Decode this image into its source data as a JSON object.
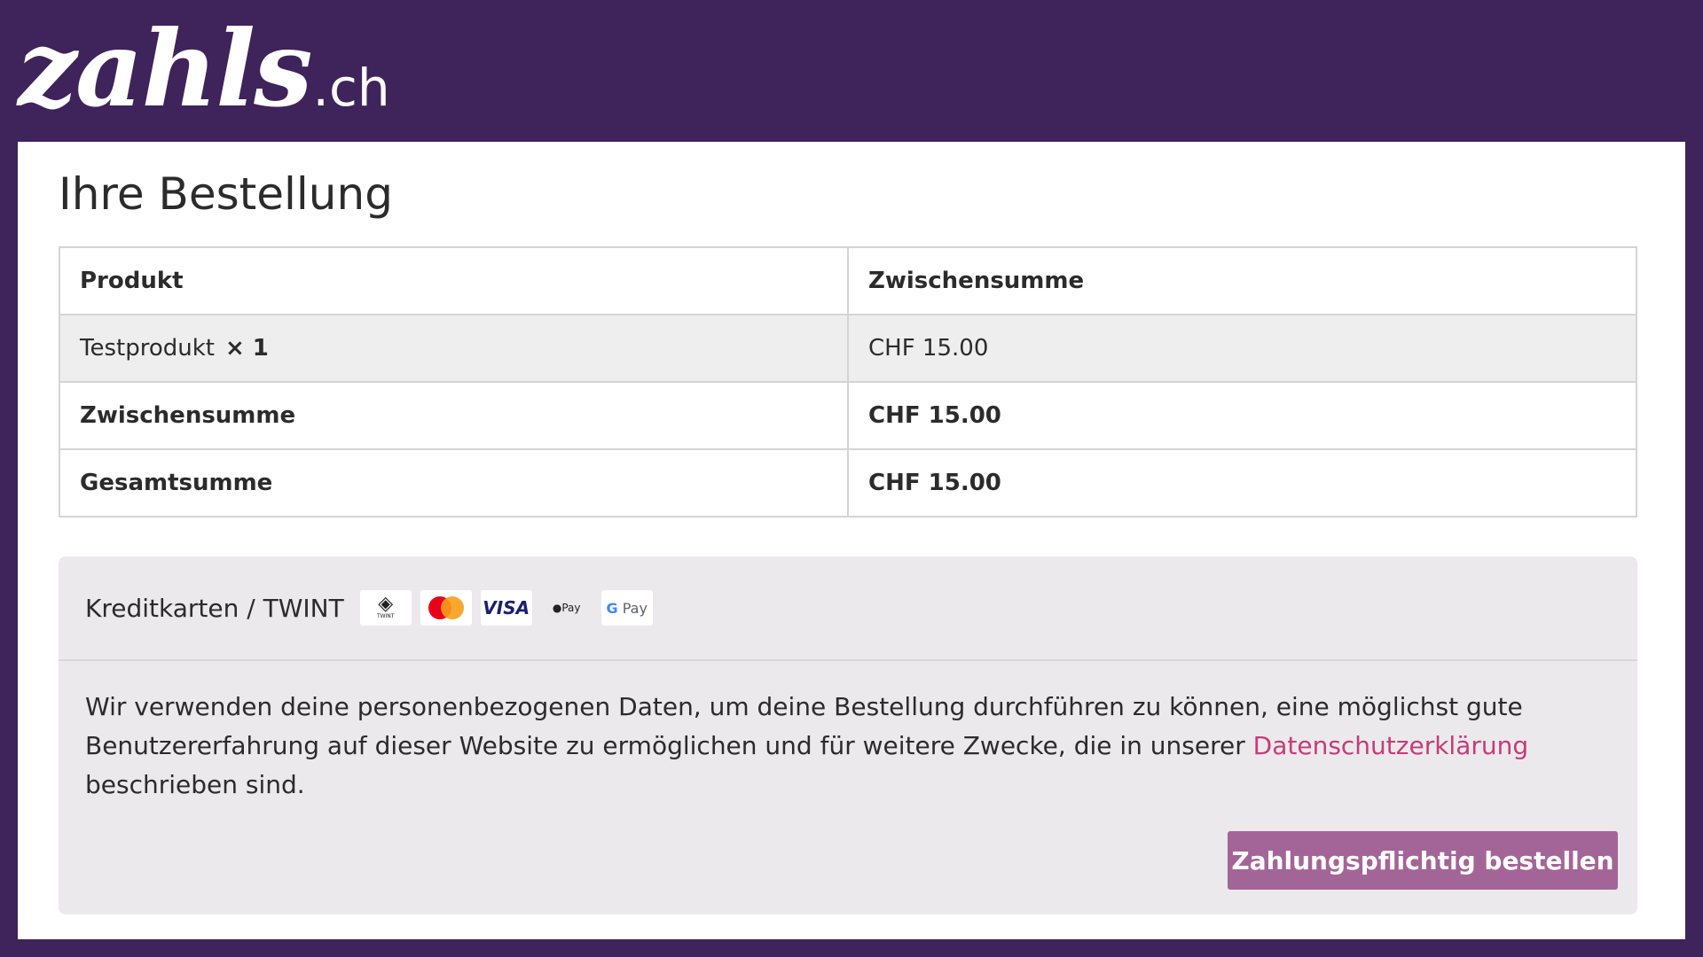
{
  "header": {
    "logo_main": "zahls",
    "logo_tld": ".ch"
  },
  "page": {
    "title": "Ihre Bestellung"
  },
  "order_table": {
    "headers": [
      "Produkt",
      "Zwischensumme"
    ],
    "item": {
      "name": "Testprodukt",
      "quantity": "× 1",
      "subtotal": "CHF 15.00"
    },
    "subtotal_row": {
      "label": "Zwischensumme",
      "value": "CHF 15.00"
    },
    "total_row": {
      "label": "Gesamtsumme",
      "value": "CHF 15.00"
    }
  },
  "payment": {
    "method_label": "Kreditkarten / TWINT",
    "icons": [
      {
        "name": "twint-icon",
        "text": "TWINT"
      },
      {
        "name": "mastercard-icon",
        "text": "mastercard"
      },
      {
        "name": "visa-icon",
        "text": "VISA"
      },
      {
        "name": "apple-pay-icon",
        "text": "Pay"
      },
      {
        "name": "google-pay-icon",
        "text": "Pay"
      }
    ],
    "privacy_text_before": "Wir verwenden deine personenbezogenen Daten, um deine Bestellung durchführen zu können, eine möglichst gute Benutzererfahrung auf dieser Website zu ermöglichen und für weitere Zwecke, die in unserer ",
    "privacy_link": "Datenschutzerklärung",
    "privacy_text_after": " beschrieben sind.",
    "order_button": "Zahlungspflichtig bestellen"
  },
  "colors": {
    "header_bg": "#3f235b",
    "button_bg": "#a36597",
    "link": "#c43c78"
  }
}
